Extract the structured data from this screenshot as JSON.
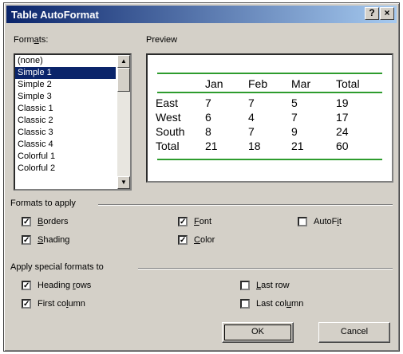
{
  "window": {
    "title": "Table AutoFormat",
    "help_glyph": "?",
    "close_glyph": "×"
  },
  "formats": {
    "label_pre": "Form",
    "label_key": "a",
    "label_post": "ts:",
    "items": [
      "(none)",
      "Simple 1",
      "Simple 2",
      "Simple 3",
      "Classic 1",
      "Classic 2",
      "Classic 3",
      "Classic 4",
      "Colorful 1",
      "Colorful 2"
    ],
    "selected": "Simple 1"
  },
  "preview": {
    "label": "Preview",
    "headers": [
      "",
      "Jan",
      "Feb",
      "Mar",
      "Total"
    ],
    "rows": [
      [
        "East",
        "7",
        "7",
        "5",
        "19"
      ],
      [
        "West",
        "6",
        "4",
        "7",
        "17"
      ],
      [
        "South",
        "8",
        "7",
        "9",
        "24"
      ],
      [
        "Total",
        "21",
        "18",
        "21",
        "60"
      ]
    ],
    "line_color": "#2e9c2e"
  },
  "formats_to_apply": {
    "label": "Formats to apply",
    "borders": {
      "key": "B",
      "rest": "orders",
      "checked": true
    },
    "shading": {
      "key": "S",
      "rest": "hading",
      "checked": true
    },
    "font": {
      "key": "F",
      "rest": "ont",
      "checked": true
    },
    "color": {
      "key": "C",
      "rest": "olor",
      "checked": true
    },
    "autofit": {
      "pre": "AutoF",
      "key": "i",
      "post": "t",
      "checked": false
    }
  },
  "special": {
    "label": "Apply special formats to",
    "heading_rows": {
      "pre": "Heading ",
      "key": "r",
      "post": "ows",
      "checked": true
    },
    "first_column": {
      "pre": "First co",
      "key": "l",
      "post": "umn",
      "checked": true
    },
    "last_row": {
      "pre": "",
      "key": "L",
      "post": "ast row",
      "checked": false
    },
    "last_column": {
      "pre": "Last col",
      "key": "u",
      "post": "mn",
      "checked": false
    }
  },
  "buttons": {
    "ok": "OK",
    "cancel": "Cancel"
  },
  "check_glyph": "✓"
}
